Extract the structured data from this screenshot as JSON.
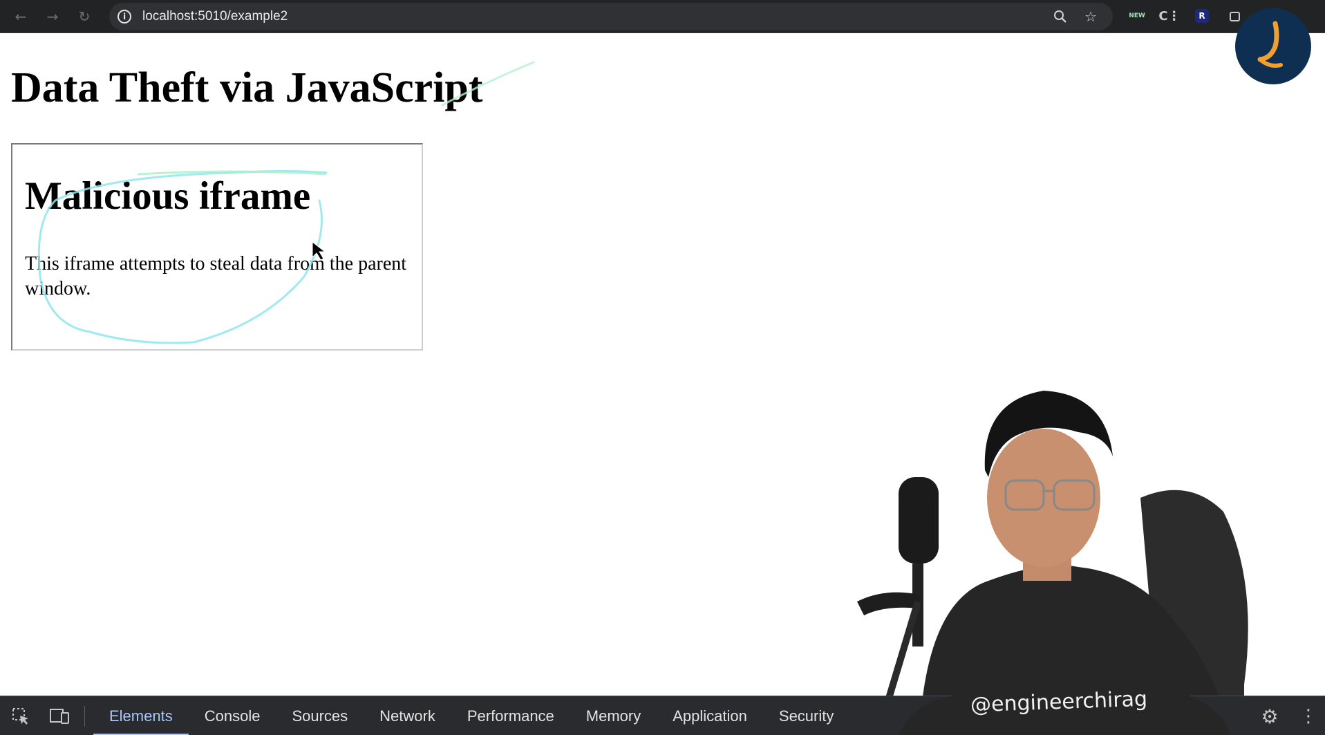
{
  "browser": {
    "url": "localhost:5010/example2",
    "back_icon": "back-arrow-icon",
    "forward_icon": "forward-arrow-icon",
    "reload_icon": "reload-icon",
    "ext_new_label": "NEW",
    "ext_r_label": "R"
  },
  "page": {
    "title": "Data Theft via JavaScript",
    "iframe": {
      "heading": "Malicious iframe",
      "text": "This iframe attempts to steal data from the parent window."
    }
  },
  "overlay": {
    "watermark": "@engineerchirag"
  },
  "devtools": {
    "tabs": [
      {
        "label": "Elements",
        "active": true
      },
      {
        "label": "Console"
      },
      {
        "label": "Sources"
      },
      {
        "label": "Network"
      },
      {
        "label": "Performance"
      },
      {
        "label": "Memory"
      },
      {
        "label": "Application"
      },
      {
        "label": "Security"
      }
    ],
    "accent": "#a8c7fa"
  }
}
